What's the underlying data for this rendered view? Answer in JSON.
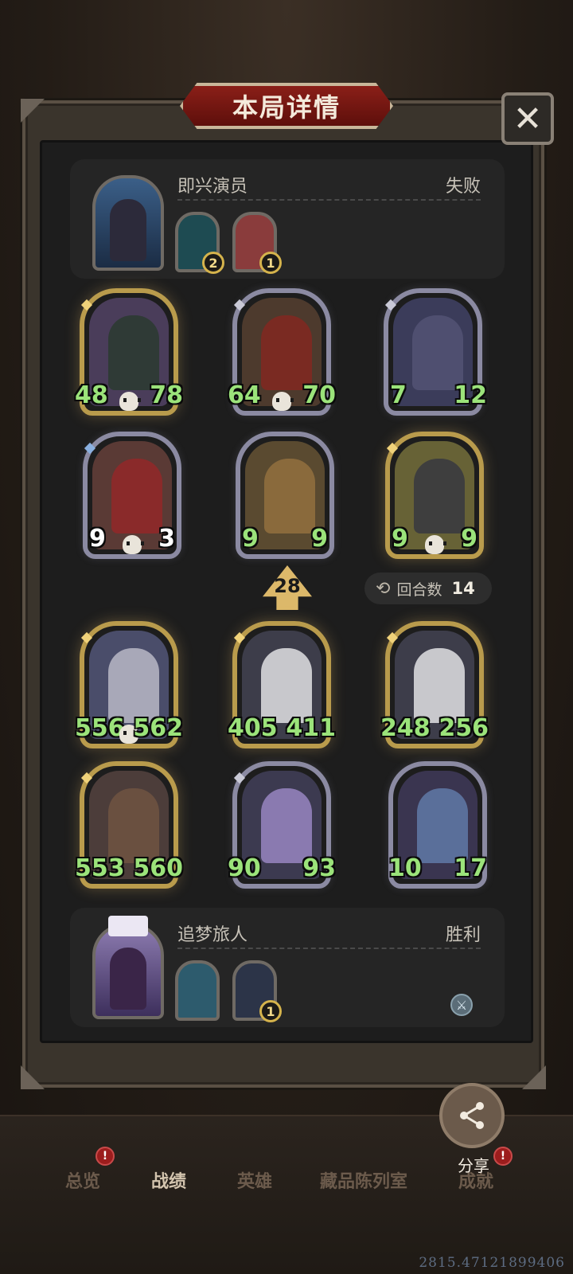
{
  "modal": {
    "title": "本局详情",
    "close_label": "✕"
  },
  "top_player": {
    "name": "即兴演员",
    "result": "失败",
    "trinkets": [
      {
        "badge": "2",
        "color": "#1e4b52"
      },
      {
        "badge": "1",
        "color": "#8a3c3c"
      }
    ],
    "cards": [
      {
        "atk": "48",
        "hp": "78",
        "frame": "gold",
        "art_color": "#4a3d5a"
      },
      {
        "atk": "64",
        "hp": "70",
        "frame": "silver",
        "art_color": "#4d3a2d"
      },
      {
        "atk": "7",
        "hp": "12",
        "frame": "silver",
        "art_color": "#3b3c5a"
      },
      {
        "atk": "9",
        "hp": "3",
        "frame": "silver",
        "art_color": "#5a3a35"
      },
      {
        "atk": "9",
        "hp": "9",
        "frame": "silver",
        "art_color": "#5a4a30"
      },
      {
        "atk": "9",
        "hp": "9",
        "frame": "gold",
        "art_color": "#676236"
      }
    ]
  },
  "turn": {
    "damage": "28",
    "round_label": "回合数",
    "round_value": "14"
  },
  "bottom_player": {
    "name": "追梦旅人",
    "result": "胜利",
    "trinkets": [
      {
        "badge": "",
        "color": "#2d5b6d"
      },
      {
        "badge": "1",
        "color": "#2c3448"
      }
    ],
    "cards": [
      {
        "atk": "556",
        "hp": "562",
        "frame": "gold",
        "art_color": "#4a4d6a"
      },
      {
        "atk": "405",
        "hp": "411",
        "frame": "gold",
        "art_color": "#3d3d4a"
      },
      {
        "atk": "248",
        "hp": "256",
        "frame": "gold",
        "art_color": "#3d3d4a"
      },
      {
        "atk": "553",
        "hp": "560",
        "frame": "gold",
        "art_color": "#4c3d3a"
      },
      {
        "atk": "90",
        "hp": "93",
        "frame": "silver",
        "art_color": "#3c3a50"
      },
      {
        "atk": "10",
        "hp": "17",
        "frame": "silver",
        "art_color": "#3a3550"
      }
    ]
  },
  "share": {
    "label": "分享",
    "icon": "share-icon"
  },
  "nav": [
    {
      "label": "总览",
      "active": false,
      "notif": "!"
    },
    {
      "label": "战绩",
      "active": true
    },
    {
      "label": "英雄",
      "active": false
    },
    {
      "label": "藏品陈列室",
      "active": false
    },
    {
      "label": "成就",
      "active": false,
      "notif": "!"
    }
  ],
  "debug_coords": "2815.47121899406",
  "colors": {
    "accent_gold": "#b99b4c",
    "stat_green": "#9be37a",
    "title_red": "#8a1f18"
  }
}
